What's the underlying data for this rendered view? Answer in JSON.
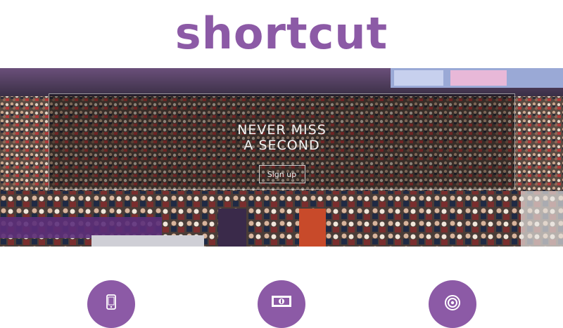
{
  "brand": {
    "logo_text": "shortcut",
    "accent": "#8c5aa6"
  },
  "hero": {
    "headline_line1": "NEVER MISS",
    "headline_line2": "A SECOND",
    "signup_label": "Sign up",
    "scene": "stadium-crowd-background"
  },
  "features": [
    {
      "icon": "mobile-phone-icon"
    },
    {
      "icon": "ticket-icon"
    },
    {
      "icon": "target-icon"
    }
  ]
}
